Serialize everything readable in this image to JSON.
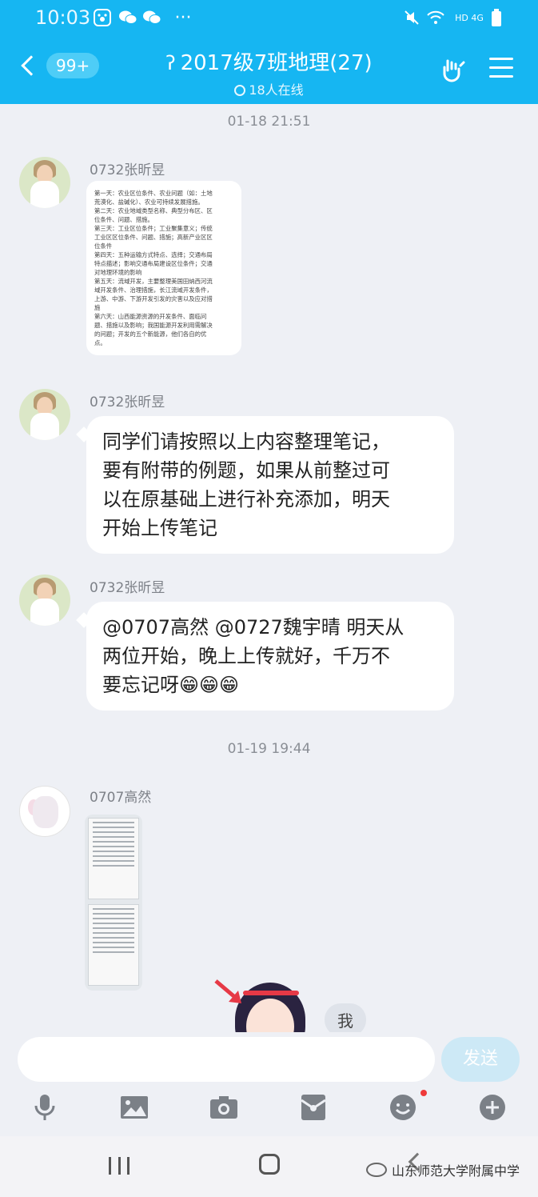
{
  "status_bar": {
    "time": "10:03",
    "network": "HD 4G"
  },
  "header": {
    "back_count": "99+",
    "title": "2017级7班地理(27)",
    "online": "18人在线"
  },
  "timestamps": [
    "01-18 21:51",
    "01-19 19:44"
  ],
  "messages": [
    {
      "sender": "0732张昕昱",
      "type": "image_text",
      "lines": [
        "第一天：农业区位条件、农业问题（如：土地",
        "荒漠化、盐碱化）、农业可持续发展措施。",
        "第二天：农业地域类型名称、典型分布区、区",
        "位条件、问题、措施。",
        "第三天：工业区位条件；工业聚集意义；传统",
        "工业区区位条件、问题、措施；高新产业区区",
        "位条件",
        "第四天：五种运输方式特点、选择；交通布局",
        "特点描述；影响交通布局建设区位条件；交通",
        "对地理环境的影响",
        "第五天：流域开发，主要整理美国田纳西河流",
        "域开发条件、治理措施，长江流域开发条件，",
        "上游、中游、下游开发引发的灾害以及应对措",
        "施",
        "第六天：山西能源资源的开发条件、面临问",
        "题、措施以及影响；我国能源开发利用需解决",
        "的问题；开发的五个新能源，他们各自的优",
        "点。"
      ]
    },
    {
      "sender": "0732张昕昱",
      "type": "text",
      "lines": [
        "同学们请按照以上内容整理笔记，",
        "要有附带的例题，如果从前整过可",
        "以在原基础上进行补充添加，明天",
        "开始上传笔记"
      ]
    },
    {
      "sender": "0732张昕昱",
      "type": "text",
      "lines": [
        "@0707高然 @0727魏宇晴 明天从",
        "两位开始，晚上上传就好，千万不",
        "要忘记呀😁😁😁"
      ]
    },
    {
      "sender": "0707高然",
      "type": "photo"
    }
  ],
  "me_label": "我",
  "input": {
    "placeholder": "",
    "send_label": "发送"
  },
  "toolbar_icons": [
    "mic-icon",
    "image-icon",
    "camera-icon",
    "red-packet-icon",
    "emoji-icon",
    "plus-icon"
  ],
  "watermark": "山东师范大学附属中学",
  "colors": {
    "header": "#16b6f2",
    "chat_bg": "#eef0f5",
    "bubble": "#ffffff",
    "send": "#cde9f6"
  }
}
